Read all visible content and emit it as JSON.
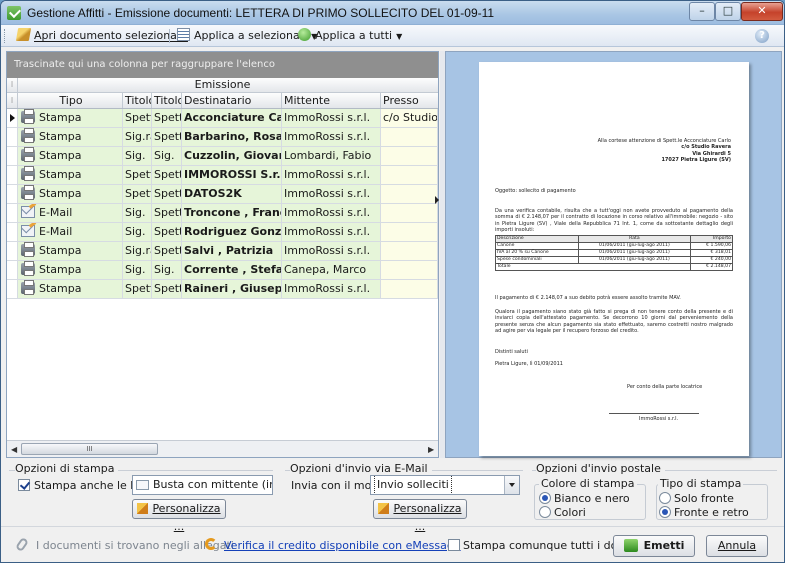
{
  "window": {
    "title": "Gestione Affitti - Emissione documenti: LETTERA DI PRIMO SOLLECITO DEL 01-09-11",
    "minimize": "–",
    "maximize": "□",
    "close": "✕"
  },
  "toolbar": {
    "open_selected": "Apri documento selezionato",
    "apply_selected": "Applica a selezionati",
    "apply_all": "Applica a tutti",
    "help": "?"
  },
  "grid": {
    "group_hint": "Trascinate qui una colonna per raggruppare l'elenco",
    "band_label": "Emissione",
    "columns": [
      "Tipo",
      "Titolo d",
      "Titolo l",
      "Destinatario",
      "Mittente",
      "Presso"
    ],
    "rows": [
      {
        "tipo": "Stampa",
        "icon": "printer-icon",
        "titolo1": "Spett.l",
        "titolo2": "Spett.l",
        "destinatario": "Acconciature Carlo",
        "mittente": "ImmoRossi s.r.l.",
        "presso": "c/o Studio Ra"
      },
      {
        "tipo": "Stampa",
        "icon": "printer-icon",
        "titolo1": "Sig.ra",
        "titolo2": "Spett.l",
        "destinatario": "Barbarino, Rosa",
        "mittente": "ImmoRossi s.r.l.",
        "presso": ""
      },
      {
        "tipo": "Stampa",
        "icon": "printer-icon",
        "titolo1": "Sig.",
        "titolo2": "Sig.",
        "destinatario": "Cuzzolin, Giovanni",
        "mittente": "Lombardi, Fabio",
        "presso": ""
      },
      {
        "tipo": "Stampa",
        "icon": "printer-icon",
        "titolo1": "Spett.l",
        "titolo2": "Spett.l",
        "destinatario": "IMMOROSSI S.r.l.",
        "mittente": "ImmoRossi s.r.l.",
        "presso": ""
      },
      {
        "tipo": "Stampa",
        "icon": "printer-icon",
        "titolo1": "Spett.l",
        "titolo2": "Spett.l",
        "destinatario": "DATOS2K",
        "mittente": "ImmoRossi s.r.l.",
        "presso": ""
      },
      {
        "tipo": "E-Mail",
        "icon": "email-icon",
        "titolo1": "Sig.",
        "titolo2": "Spett.l",
        "destinatario": "Troncone , Francesco",
        "mittente": "ImmoRossi s.r.l.",
        "presso": ""
      },
      {
        "tipo": "E-Mail",
        "icon": "email-icon",
        "titolo1": "Sig.",
        "titolo2": "Spett.l",
        "destinatario": "Rodriguez Gonzalez,",
        "mittente": "ImmoRossi s.r.l.",
        "presso": ""
      },
      {
        "tipo": "Stampa",
        "icon": "printer-icon",
        "titolo1": "Sig.ra",
        "titolo2": "Spett.l",
        "destinatario": "Salvi , Patrizia",
        "mittente": "ImmoRossi s.r.l.",
        "presso": ""
      },
      {
        "tipo": "Stampa",
        "icon": "printer-icon",
        "titolo1": "Sig.",
        "titolo2": "Sig.",
        "destinatario": "Corrente , Stefano",
        "mittente": "Canepa, Marco",
        "presso": ""
      },
      {
        "tipo": "Stampa",
        "icon": "printer-icon",
        "titolo1": "Spett.l",
        "titolo2": "Spett.l",
        "destinatario": "Raineri , Giuseppe",
        "mittente": "ImmoRossi s.r.l.",
        "presso": ""
      }
    ],
    "scroll_grip": "III"
  },
  "preview": {
    "addressee": [
      "Alla cortese attenzione di Spett.le Acconciature Carlo",
      "c/o Studio Ravera",
      "Via Ghirardi 5",
      "17027 Pietra Ligure (SV)"
    ],
    "subject": "Oggetto: sollecito di pagamento",
    "body": "Da una verifica contabile, risulta che a tutt'oggi non avete provveduto al pagamento della somma di € 2.148,07 per il contratto di locazione in corso relativo all'immobile: negozio - sito in Pietra Ligure (SV) , Viale della Repubblica 71 Int. 1, come da sottostante dettaglio degli importi insoluti:",
    "table_header": [
      "Descrizione",
      "Rata",
      "Importo"
    ],
    "table_rows": [
      [
        "Canone",
        "01/06/2011 (giu-lug-ago 2011)",
        "€ 1.590,06"
      ],
      [
        "IVA al 20 % su Canone",
        "01/06/2011 (giu-lug-ago 2011)",
        "€ 318,01"
      ],
      [
        "Spese condominiali",
        "01/06/2011 (giu-lug-ago 2011)",
        "€ 240,00"
      ]
    ],
    "table_total_label": "Totale",
    "table_total": "€ 2.148,07",
    "payment": "Il pagamento di € 2.148,07 a suo debito potrà essere assolto tramite MAV.",
    "paragraph": "Qualora il pagamento siano stato già fatto si prega di non tenere conto della presente e di inviarci copia dell'attestato pagamento. Se decorrono 10 giorni dal perveniemento della presente senza che alcun pagamento sia stato effettuato, saremo costretti nostro malgrado ad agire per via legale per il recupero forzoso del credito.",
    "greeting": "Distinti saluti",
    "place_date": "Pietra Ligure, lì 01/09/2011",
    "landlord": "Per conto della parte locatrice",
    "signature": "ImmoRossi s.r.l."
  },
  "options": {
    "print_title": "Opzioni di stampa",
    "print_envelopes": "Stampa anche le buste",
    "envelope_mode": "Busta con mittente (ins. ve",
    "customize": "Personalizza ...",
    "email_title": "Opzioni d'invio via E-Mail",
    "email_model_label": "Invia con il modello",
    "email_model": "Invio solleciti",
    "postal_title": "Opzioni d'invio postale",
    "color_group": "Colore di stampa",
    "color_bw": "Bianco e nero",
    "color_color": "Colori",
    "type_group": "Tipo di stampa",
    "type_front": "Solo fronte",
    "type_duplex": "Fronte e retro"
  },
  "status": {
    "attachments_note": "I documenti si trovano negli allegati",
    "credit_link": "Verifica il credito disponibile con eMessage",
    "print_all": "Stampa comunque tutti i documenti",
    "emit": "Emetti",
    "cancel": "Annula"
  }
}
